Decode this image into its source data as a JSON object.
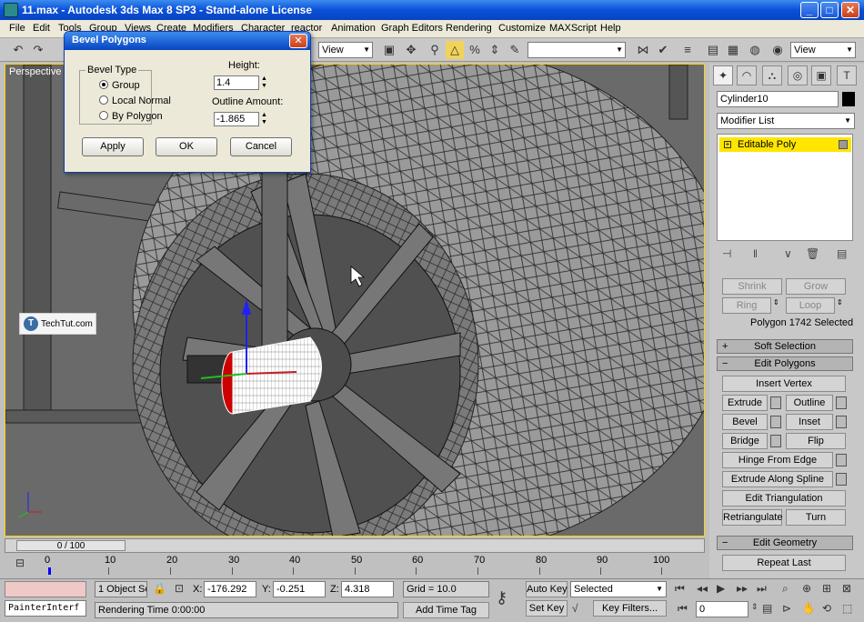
{
  "window": {
    "title": "11.max - Autodesk 3ds Max 8 SP3 - Stand-alone License",
    "minimize": "_",
    "maximize": "□",
    "close": "✕"
  },
  "menu": [
    "File",
    "Edit",
    "Tools",
    "Group",
    "Views",
    "Create",
    "Modifiers",
    "Character",
    "reactor",
    "Animation",
    "Graph Editors",
    "Rendering",
    "Customize",
    "MAXScript",
    "Help"
  ],
  "toolbar": {
    "view_dropdown_left": "View",
    "selection_set": "",
    "view_dropdown_right": "View"
  },
  "viewport": {
    "label": "Perspective",
    "watermark": "TechTut.com",
    "watermark_icon": "T"
  },
  "dialog": {
    "title": "Bevel Polygons",
    "close": "✕",
    "bevel_type_label": "Bevel Type",
    "options": [
      {
        "label": "Group",
        "checked": true
      },
      {
        "label": "Local Normal",
        "checked": false
      },
      {
        "label": "By Polygon",
        "checked": false
      }
    ],
    "height_label": "Height:",
    "height_value": "1.4",
    "outline_label": "Outline Amount:",
    "outline_value": "-1.865",
    "buttons": {
      "apply": "Apply",
      "ok": "OK",
      "cancel": "Cancel"
    }
  },
  "command_panel": {
    "object_name": "Cylinder10",
    "modifier_list": "Modifier List",
    "stack_item": "Editable Poly",
    "selection": {
      "shrink": "Shrink",
      "grow": "Grow",
      "ring": "Ring",
      "loop": "Loop",
      "status": "Polygon 1742 Selected"
    },
    "soft_selection": "Soft Selection",
    "edit_polygons": "Edit Polygons",
    "edit_polygons_buttons": {
      "insert_vertex": "Insert Vertex",
      "extrude": "Extrude",
      "outline": "Outline",
      "bevel": "Bevel",
      "inset": "Inset",
      "bridge": "Bridge",
      "flip": "Flip",
      "hinge_from_edge": "Hinge From Edge",
      "extrude_along_spline": "Extrude Along Spline",
      "edit_triangulation": "Edit Triangulation",
      "retriangulate": "Retriangulate",
      "turn": "Turn"
    },
    "edit_geometry": "Edit Geometry",
    "repeat_last": "Repeat Last"
  },
  "timeline": {
    "frame": "0 / 100",
    "ticks": [
      "0",
      "10",
      "20",
      "30",
      "40",
      "50",
      "60",
      "70",
      "80",
      "90",
      "100"
    ]
  },
  "status": {
    "script_listener": "PainterInterf",
    "objects_selected": "1 Object Se",
    "x_label": "X:",
    "x_value": "-176.292",
    "y_label": "Y:",
    "y_value": "-0.251",
    "z_label": "Z:",
    "z_value": "4.318",
    "grid": "Grid = 10.0",
    "rendering_time": "Rendering Time  0:00:00",
    "add_time_tag": "Add Time Tag",
    "auto_key": "Auto Key",
    "set_key": "Set Key",
    "key_mode": "Selected",
    "key_filters": "Key Filters...",
    "current_frame": "0"
  }
}
